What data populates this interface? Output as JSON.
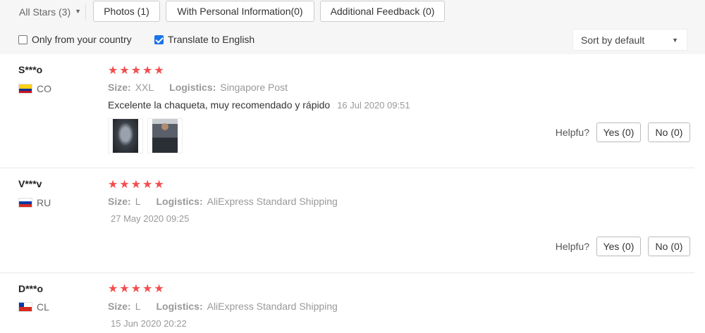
{
  "filters": {
    "star_select_label": "All Stars (3)",
    "chevron_icon": "chevron-down-icon",
    "buttons": [
      {
        "label": "Photos (1)"
      },
      {
        "label": "With Personal Information(0)"
      },
      {
        "label": "Additional Feedback (0)"
      }
    ],
    "checkboxes": [
      {
        "label": "Only from your country",
        "checked": false
      },
      {
        "label": "Translate to English",
        "checked": true
      }
    ],
    "sort_label": "Sort by default"
  },
  "reviews": [
    {
      "user": "S***o",
      "country": "CO",
      "stars": 5,
      "size_key": "Size:",
      "size_value": "XXL",
      "logistics_key": "Logistics:",
      "logistics_value": "Singapore Post",
      "text": "Excelente la chaqueta, muy recomendado y rápido",
      "date": "16 Jul 2020 09:51",
      "photo_count": 2,
      "helpful_label": "Helpfu?",
      "yes_label": "Yes (0)",
      "no_label": "No (0)"
    },
    {
      "user": "V***v",
      "country": "RU",
      "stars": 5,
      "size_key": "Size:",
      "size_value": "L",
      "logistics_key": "Logistics:",
      "logistics_value": "AliExpress Standard Shipping",
      "text": "",
      "date": "27 May 2020 09:25",
      "photo_count": 0,
      "helpful_label": "Helpfu?",
      "yes_label": "Yes (0)",
      "no_label": "No (0)"
    },
    {
      "user": "D***o",
      "country": "CL",
      "stars": 5,
      "size_key": "Size:",
      "size_value": "L",
      "logistics_key": "Logistics:",
      "logistics_value": "AliExpress Standard Shipping",
      "text": "",
      "date": "15 Jun 2020 20:22",
      "photo_count": 0
    }
  ],
  "colors": {
    "star": "#f24e4e",
    "checkbox_on": "#1a73e8",
    "filter_bg": "#f6f6f6"
  }
}
